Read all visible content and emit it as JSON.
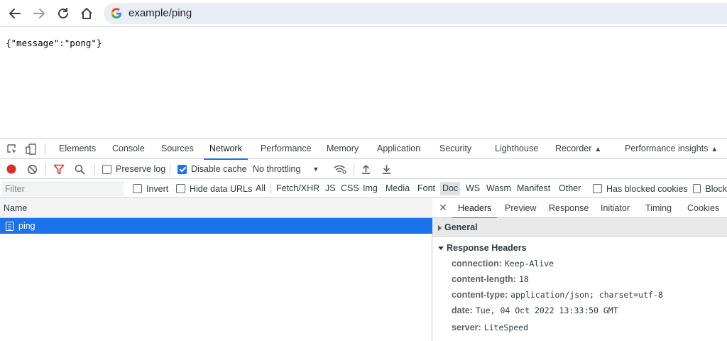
{
  "browser": {
    "url": "example/ping",
    "icons": [
      "back-icon",
      "forward-icon",
      "reload-icon",
      "home-icon",
      "google-icon"
    ]
  },
  "page": {
    "body_text": "{\"message\":\"pong\"}"
  },
  "devtools": {
    "tabs": [
      "Elements",
      "Console",
      "Sources",
      "Network",
      "Performance",
      "Memory",
      "Application",
      "Security",
      "Lighthouse",
      "Recorder",
      "Performance insights"
    ],
    "active_tab": "Network",
    "toolbar": {
      "preserve_log": "Preserve log",
      "preserve_log_checked": false,
      "disable_cache": "Disable cache",
      "disable_cache_checked": true,
      "throttling": "No throttling"
    },
    "filter": {
      "placeholder": "Filter",
      "invert": "Invert",
      "hide_data_urls": "Hide data URLs",
      "types": [
        "All",
        "Fetch/XHR",
        "JS",
        "CSS",
        "Img",
        "Media",
        "Font",
        "Doc",
        "WS",
        "Wasm",
        "Manifest",
        "Other"
      ],
      "selected_type": "Doc",
      "has_blocked_cookies": "Has blocked cookies",
      "blocked_truncated": "Block"
    },
    "request_list": {
      "header": "Name",
      "rows": [
        {
          "name": "ping",
          "selected": true
        }
      ]
    },
    "detail": {
      "tabs": [
        "Headers",
        "Preview",
        "Response",
        "Initiator",
        "Timing",
        "Cookies"
      ],
      "active_tab": "Headers",
      "general_label": "General",
      "response_headers_label": "Response Headers",
      "response_headers": [
        {
          "name": "connection:",
          "value": "Keep-Alive"
        },
        {
          "name": "content-length:",
          "value": "18"
        },
        {
          "name": "content-type:",
          "value": "application/json; charset=utf-8"
        },
        {
          "name": "date:",
          "value": "Tue, 04 Oct 2022 13:33:50 GMT"
        },
        {
          "name": "server:",
          "value": "LiteSpeed"
        }
      ]
    }
  },
  "colors": {
    "accent": "#1a73e8",
    "record": "#d93025",
    "filter_icon": "#d93025"
  }
}
